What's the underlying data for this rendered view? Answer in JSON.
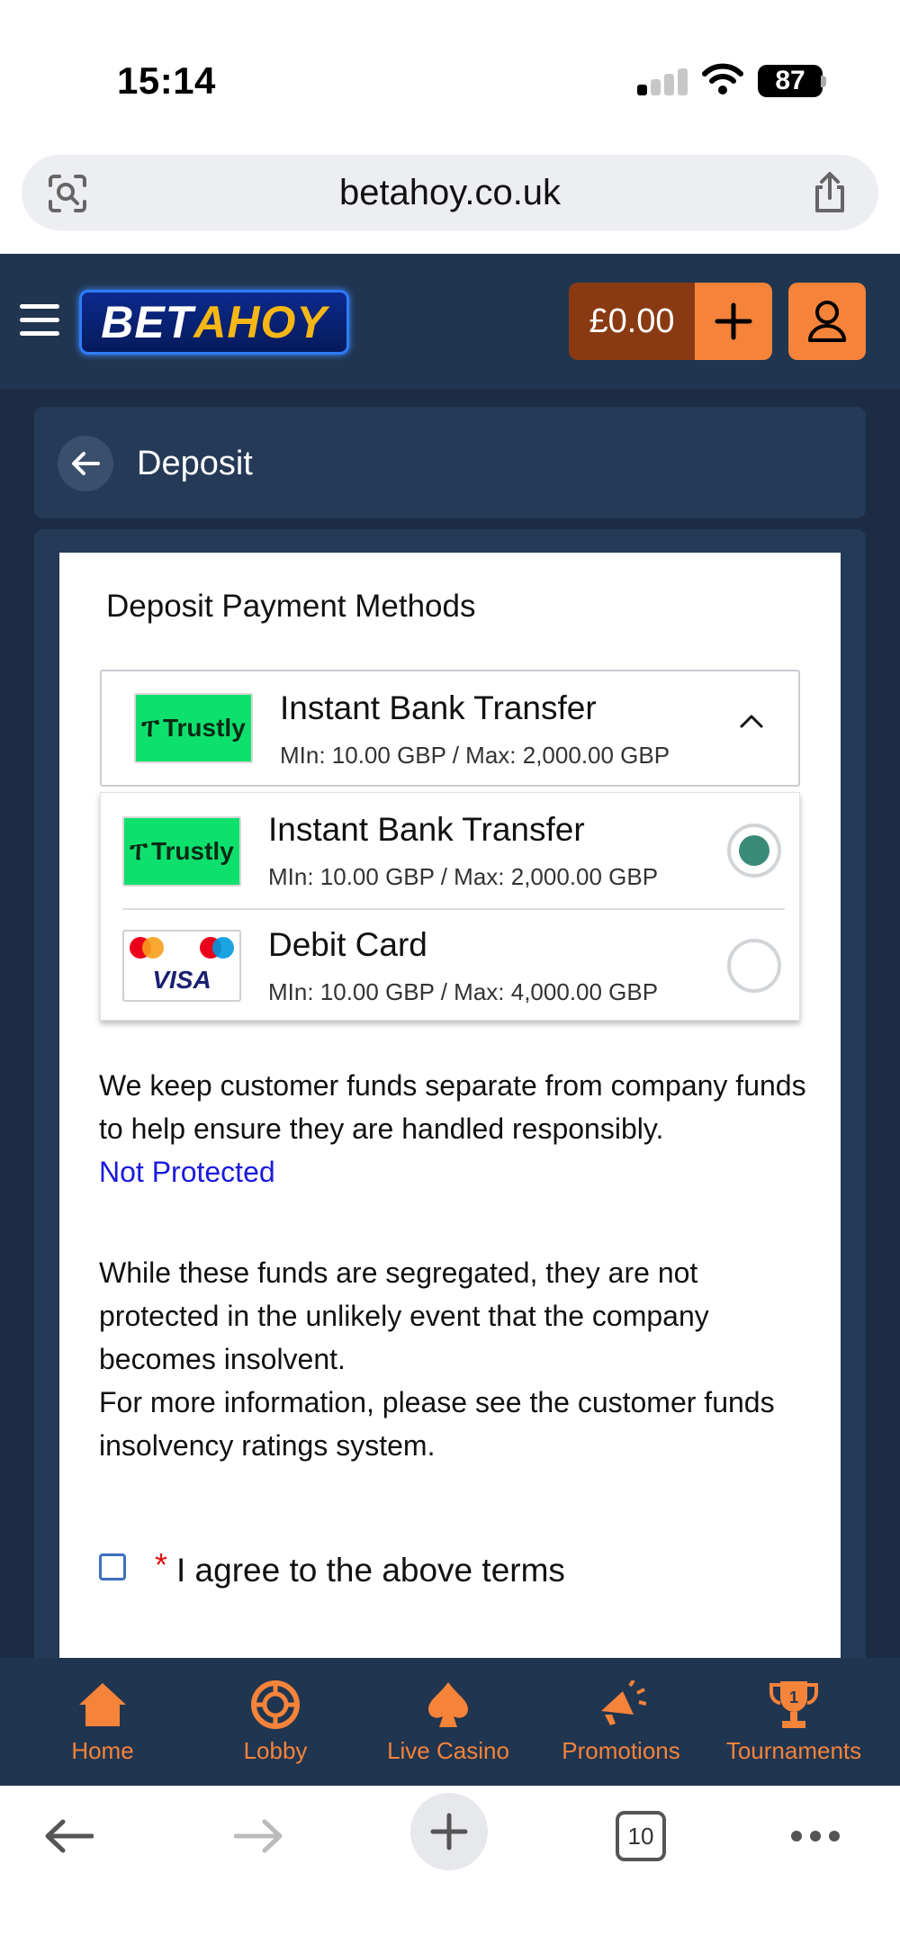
{
  "status_bar": {
    "time": "15:14",
    "battery": "87"
  },
  "browser": {
    "url": "betahoy.co.uk",
    "tabs_count": "10"
  },
  "header": {
    "logo_part1": "BET",
    "logo_part2": "AHOY",
    "balance": "£0.00"
  },
  "page": {
    "title": "Deposit"
  },
  "card": {
    "title": "Deposit Payment Methods",
    "selected_method": {
      "logo_text": "Trustly",
      "name": "Instant Bank Transfer",
      "limits": "MIn: 10.00 GBP / Max: 2,000.00 GBP"
    },
    "methods": [
      {
        "logo_text": "Trustly",
        "name": "Instant Bank Transfer",
        "limits": "MIn: 10.00 GBP / Max: 2,000.00 GBP",
        "selected": true
      },
      {
        "logo_text": "VISA",
        "name": "Debit Card",
        "limits": "MIn: 10.00 GBP / Max: 4,000.00 GBP",
        "selected": false
      }
    ],
    "info_paragraph1": "We keep customer funds separate from company funds to help ensure they are handled responsibly.",
    "protection_link": "Not Protected",
    "info_paragraph2": "While these funds are segregated, they are not protected in the unlikely event that the company becomes insolvent.",
    "info_paragraph3": "For more information, please see the customer funds insolvency ratings system.",
    "required_mark": "*",
    "agree_label": "I agree to the above terms"
  },
  "bottom_nav": {
    "items": [
      {
        "label": "Home",
        "icon": "home-icon"
      },
      {
        "label": "Lobby",
        "icon": "chip-icon"
      },
      {
        "label": "Live Casino",
        "icon": "spade-icon"
      },
      {
        "label": "Promotions",
        "icon": "megaphone-icon"
      },
      {
        "label": "Tournaments",
        "icon": "trophy-icon"
      }
    ],
    "trophy_number": "1"
  },
  "colors": {
    "header_bg": "#203550",
    "accent_orange": "#f5833a",
    "balance_bg": "#8a3a12",
    "trustly_green": "#0ee06e",
    "radio_selected": "#3a8a78",
    "link_blue": "#1a1adc"
  }
}
